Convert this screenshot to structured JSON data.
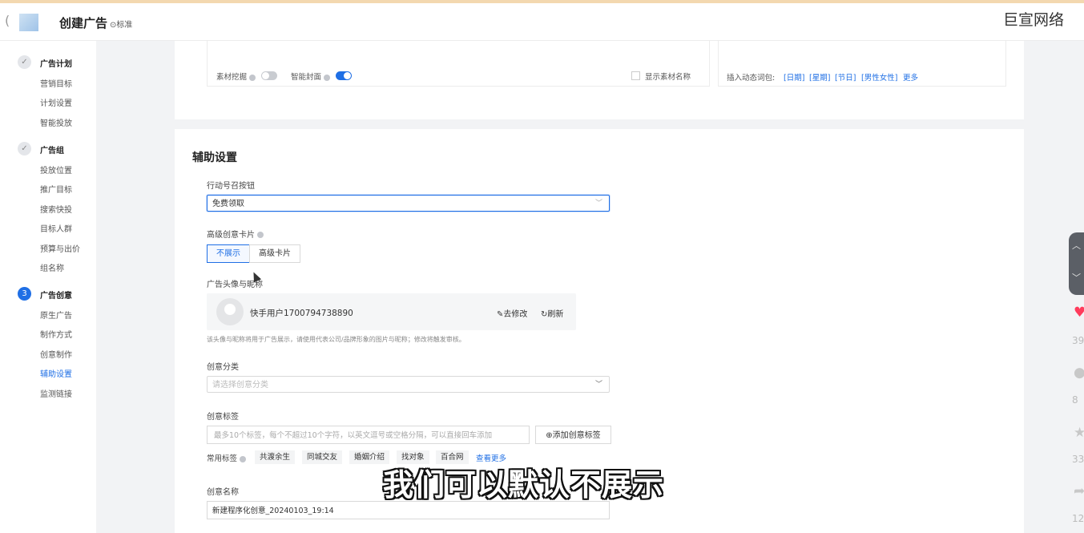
{
  "header": {
    "title": "创建广告",
    "badge": "⊙标准",
    "watermark": "巨宣网络"
  },
  "sidebar": {
    "steps": [
      {
        "index": "✓",
        "label": "广告计划",
        "items": [
          "营销目标",
          "计划设置",
          "智能投放"
        ]
      },
      {
        "index": "✓",
        "label": "广告组",
        "items": [
          "投放位置",
          "推广目标",
          "搜索快投",
          "目标人群",
          "预算与出价",
          "组名称"
        ]
      },
      {
        "index": "3",
        "label": "广告创意",
        "items": [
          "原生广告",
          "制作方式",
          "创意制作",
          "辅助设置",
          "监测链接"
        ]
      }
    ],
    "active_item": "辅助设置"
  },
  "top_card": {
    "material_mining_label": "素材挖掘",
    "smart_cover_label": "智能封面",
    "show_material_name_label": "显示素材名称",
    "dynamic_words_label": "插入动态词包:",
    "dynamic_words": [
      "[日期]",
      "[星期]",
      "[节日]",
      "[男性女性]",
      "更多"
    ]
  },
  "aux": {
    "section_title": "辅助设置",
    "cta_label": "行动号召按钮",
    "cta_value": "免费领取",
    "adv_card_label": "高级创意卡片",
    "adv_card_options": [
      "不展示",
      "高级卡片"
    ],
    "avatar_label": "广告头像与昵称",
    "nickname": "快手用户1700794738890",
    "edit_label": "去修改",
    "refresh_label": "刷新",
    "avatar_help": "该头像与昵称将用于广告展示，请使用代表公司/品牌形象的图片与昵称；修改将触发审核。",
    "category_label": "创意分类",
    "category_placeholder": "请选择创意分类",
    "tags_label": "创意标签",
    "tags_placeholder": "最多10个标签，每个不超过10个字符，以英文逗号或空格分隔，可以直接回车添加",
    "add_tag_label": "⊕添加创意标签",
    "common_tags_label": "常用标签",
    "common_tags": [
      "共渡余生",
      "同城交友",
      "婚姻介绍",
      "找对象",
      "百合网"
    ],
    "view_more": "查看更多",
    "creative_name_label": "创意名称",
    "creative_name_value": "新建程序化创意_20240103_19:14"
  },
  "subtitle": "我们可以默认不展示",
  "right_panel": {
    "counts": [
      "39",
      "8",
      "33",
      "12"
    ]
  }
}
